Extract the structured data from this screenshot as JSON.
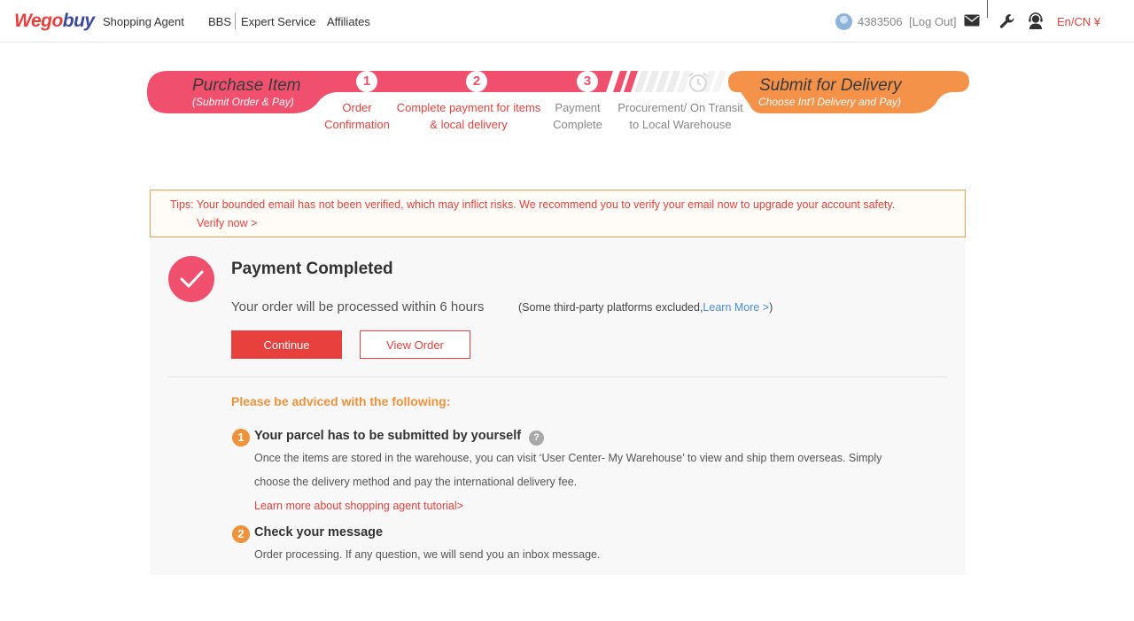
{
  "header": {
    "logo_part1": "Wego",
    "logo_part2": "buy",
    "nav": [
      "Shopping Agent",
      "BBS",
      "Expert Service",
      "Affiliates"
    ],
    "user_id": "4383506",
    "logout": "[Log Out]",
    "language": "En/CN ¥",
    "icons": [
      "avatar",
      "mail-icon",
      "wrench-icon",
      "customer-service-icon"
    ]
  },
  "steps": {
    "phase1_title": "Purchase Item",
    "phase1_sub": "(Submit Order & Pay)",
    "phase2_title": "Submit for Delivery",
    "phase2_sub": "Choose Int'l Delivery and Pay)",
    "items": [
      {
        "num": "1",
        "line1": "Order",
        "line2": "Confirmation"
      },
      {
        "num": "2",
        "line1": "Complete payment for items",
        "line2": "& local delivery"
      },
      {
        "num": "3",
        "line1": "Payment",
        "line2": "Complete"
      },
      {
        "num": "",
        "line1": "Procurement/ On Transit",
        "line2": "to Local Warehouse"
      }
    ]
  },
  "tips": {
    "text": "Tips: Your bounded email has not been verified, which may inflict risks. We recommend you to verify your email now to upgrade your account safety.",
    "link": "Verify now >"
  },
  "result": {
    "title": "Payment Completed",
    "processing": "Your order will be processed within 6 hours",
    "excluded_prefix": "(Some third-party platforms excluded,",
    "learn_more": "Learn More >",
    "excluded_suffix": ")",
    "continue_label": "Continue",
    "view_order_label": "View Order"
  },
  "advice": {
    "heading": "Please be adviced with the following:",
    "item1_num": "1",
    "item1_title": "Your parcel has to be submitted by yourself",
    "item1_help": "?",
    "item1_line1": "Once the items are stored in the warehouse, you can visit ‘User Center- My Warehouse’ to view and ship them overseas. Simply",
    "item1_line2": "choose the delivery method and pay the international delivery fee.",
    "item1_link": "Learn more about shopping agent tutorial>",
    "item2_num": "2",
    "item2_title": "Check your message",
    "item2_line1": "Order processing. If any question, we will send you an inbox message."
  },
  "colors": {
    "brand_red": "#e8403c",
    "pink": "#f0506e",
    "orange": "#f0923a",
    "link_blue": "#4a8fd8"
  }
}
